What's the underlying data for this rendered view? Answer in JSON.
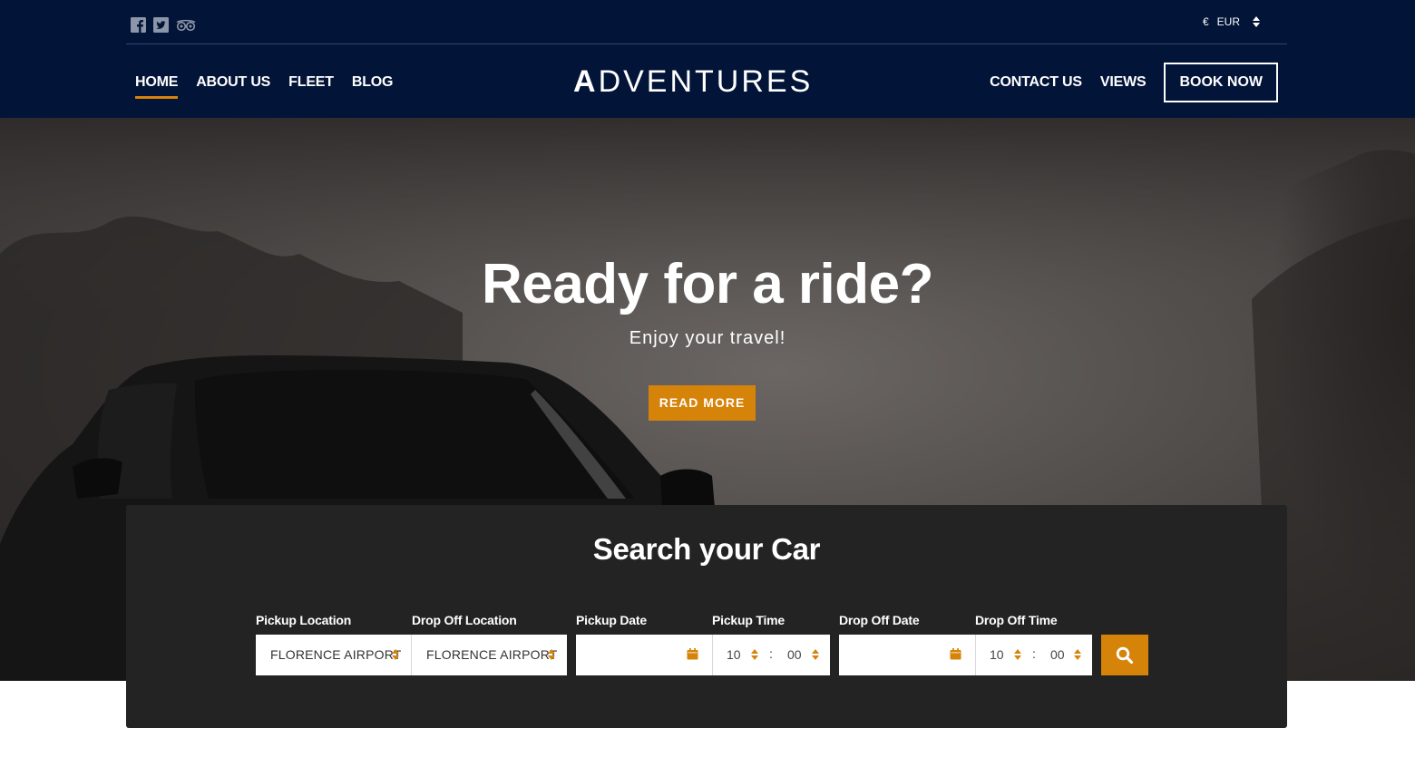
{
  "header": {
    "social_icons": [
      "facebook-icon",
      "twitter-icon",
      "tripadvisor-icon"
    ],
    "currency": {
      "symbol": "€",
      "code": "EUR"
    },
    "nav_left": [
      {
        "label": "HOME",
        "active": true
      },
      {
        "label": "ABOUT US"
      },
      {
        "label": "FLEET"
      },
      {
        "label": "BLOG"
      }
    ],
    "logo": {
      "first": "A",
      "rest": "DVENTURES"
    },
    "nav_right": [
      {
        "label": "CONTACT US"
      },
      {
        "label": "VIEWS"
      }
    ],
    "book_now": "BOOK NOW"
  },
  "hero": {
    "title": "Ready for a ride?",
    "subtitle": "Enjoy your travel!",
    "cta": "READ MORE"
  },
  "search": {
    "title": "Search your Car",
    "pickup_location": {
      "label": "Pickup Location",
      "value": "FLORENCE AIRPORT"
    },
    "dropoff_location": {
      "label": "Drop Off Location",
      "value": "FLORENCE AIRPORT"
    },
    "pickup_date": {
      "label": "Pickup Date",
      "value": ""
    },
    "pickup_time": {
      "label": "Pickup Time",
      "hour": "10",
      "minute": "00"
    },
    "dropoff_date": {
      "label": "Drop Off Date",
      "value": ""
    },
    "dropoff_time": {
      "label": "Drop Off Time",
      "hour": "10",
      "minute": "00"
    },
    "colon": ":",
    "search_icon": "search-icon"
  },
  "colors": {
    "navy": "#021438",
    "accent": "#d6830a",
    "panel": "#232323"
  }
}
